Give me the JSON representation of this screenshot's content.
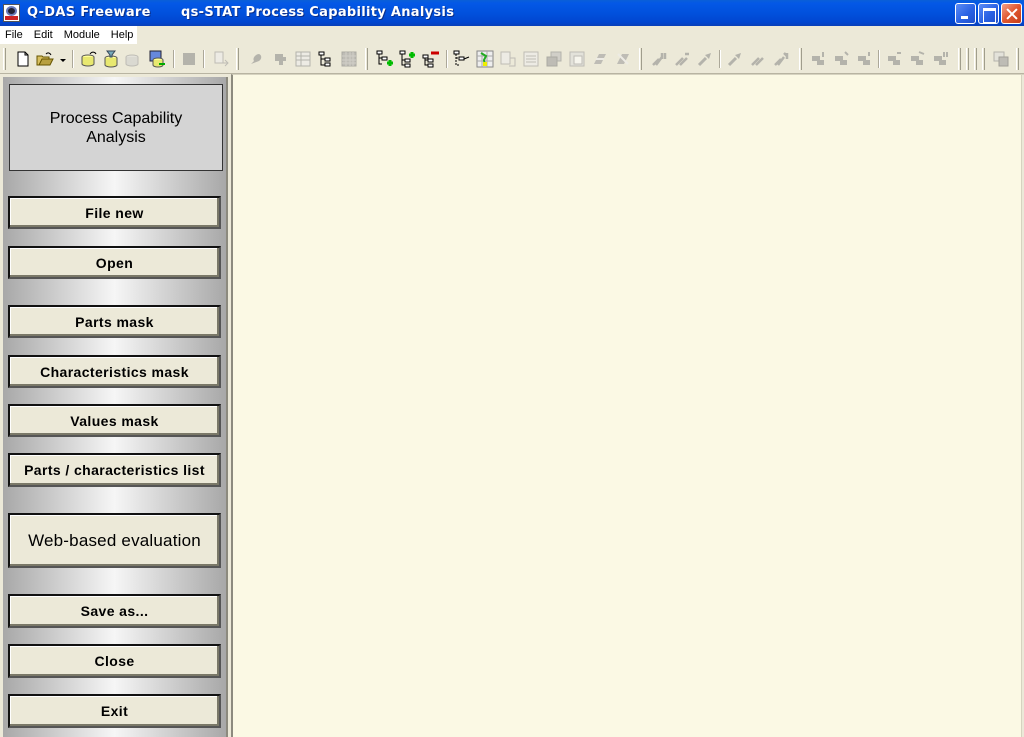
{
  "window": {
    "app_name": "Q-DAS Freeware",
    "title": "qs-STAT Process Capability Analysis",
    "controls": [
      "minimize",
      "maximize",
      "close"
    ]
  },
  "menu": {
    "items": [
      "File",
      "Edit",
      "Module",
      "Help"
    ]
  },
  "toolbar": {
    "icons": [
      {
        "name": "new-file-icon",
        "enabled": true
      },
      {
        "name": "open-folder-icon",
        "enabled": true
      },
      {
        "name": "dropdown-arrow-icon",
        "enabled": true
      },
      {
        "name": "database-load-icon",
        "enabled": true
      },
      {
        "name": "database-filter-icon",
        "enabled": true
      },
      {
        "name": "database-delete-icon",
        "enabled": false
      },
      {
        "name": "database-export-icon",
        "enabled": true
      },
      {
        "name": "stop-icon",
        "enabled": false
      },
      {
        "name": "transfer-icon",
        "enabled": false
      },
      {
        "name": "paint-icon",
        "enabled": false
      },
      {
        "name": "part-icon",
        "enabled": false
      },
      {
        "name": "table-icon",
        "enabled": false
      },
      {
        "name": "tree-icon",
        "enabled": true
      },
      {
        "name": "grid-icon",
        "enabled": false
      },
      {
        "name": "tree-add-icon",
        "enabled": true
      },
      {
        "name": "tree-insert-icon",
        "enabled": true
      },
      {
        "name": "tree-remove-icon",
        "enabled": true
      },
      {
        "name": "tree-edit-icon",
        "enabled": true
      },
      {
        "name": "grid-select-icon",
        "enabled": true
      },
      {
        "name": "copy-icon",
        "enabled": false
      },
      {
        "name": "list-icon",
        "enabled": false
      },
      {
        "name": "cascade-icon",
        "enabled": false
      },
      {
        "name": "window-icon",
        "enabled": false
      },
      {
        "name": "link-icon",
        "enabled": false
      },
      {
        "name": "unlink-icon",
        "enabled": false
      },
      {
        "name": "first-icon",
        "enabled": false
      },
      {
        "name": "previous-fast-icon",
        "enabled": false
      },
      {
        "name": "previous-icon",
        "enabled": false
      },
      {
        "name": "next-icon",
        "enabled": false
      },
      {
        "name": "next-fast-icon",
        "enabled": false
      },
      {
        "name": "last-icon",
        "enabled": false
      },
      {
        "name": "char-first-icon",
        "enabled": false
      },
      {
        "name": "char-previous-fast-icon",
        "enabled": false
      },
      {
        "name": "char-previous-icon",
        "enabled": false
      },
      {
        "name": "char-next-icon",
        "enabled": false
      },
      {
        "name": "char-next-fast-icon",
        "enabled": false
      },
      {
        "name": "char-last-icon",
        "enabled": false
      },
      {
        "name": "window-arrange-icon",
        "enabled": false
      }
    ]
  },
  "panel": {
    "title": "Process Capability Analysis",
    "buttons": [
      {
        "label": "File new"
      },
      {
        "label": "Open"
      },
      {
        "label": "Parts mask"
      },
      {
        "label": "Characteristics mask"
      },
      {
        "label": "Values mask"
      },
      {
        "label": "Parts / characteristics list"
      },
      {
        "label": "Web-based evaluation"
      },
      {
        "label": "Save as..."
      },
      {
        "label": "Close"
      },
      {
        "label": "Exit"
      }
    ]
  },
  "colors": {
    "titlebar": "#0151dd",
    "workspace": "#fbf9e4",
    "button_face": "#ece9d8",
    "close_button": "#e0572f"
  }
}
